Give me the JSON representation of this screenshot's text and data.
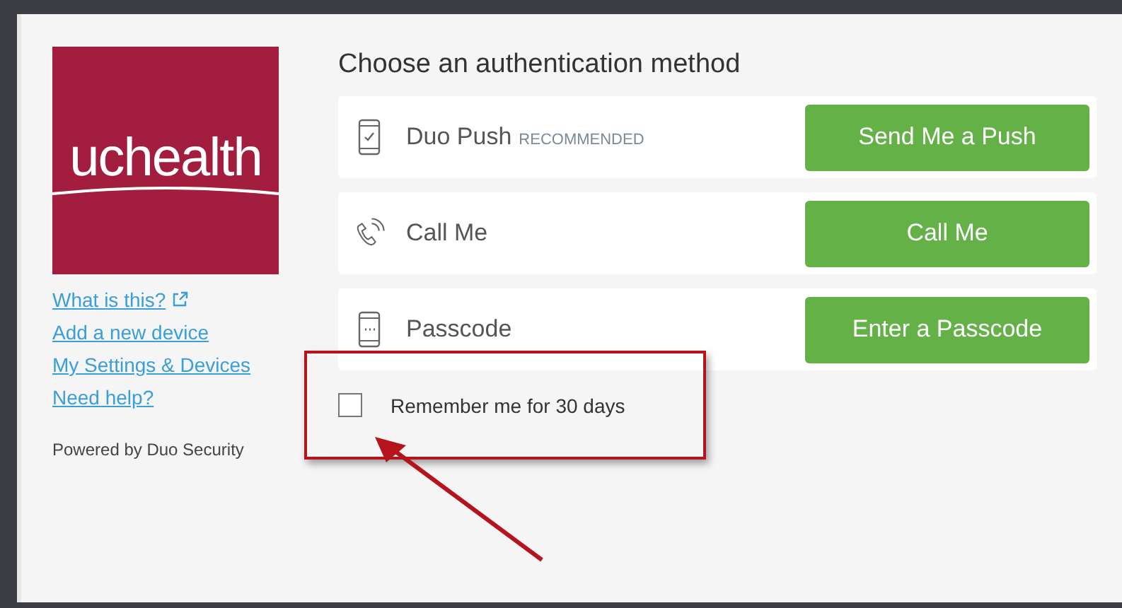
{
  "logo": {
    "text": "uchealth"
  },
  "links": [
    {
      "label": "What is this?",
      "external": true
    },
    {
      "label": "Add a new device",
      "external": false
    },
    {
      "label": "My Settings & Devices",
      "external": false
    },
    {
      "label": "Need help?",
      "external": false
    }
  ],
  "powered_by": "Powered by Duo Security",
  "heading": "Choose an authentication method",
  "methods": [
    {
      "kind": "push",
      "name": "Duo Push",
      "badge": "RECOMMENDED",
      "button": "Send Me a Push"
    },
    {
      "kind": "call",
      "name": "Call Me",
      "button": "Call Me"
    },
    {
      "kind": "passcode",
      "name": "Passcode",
      "button": "Enter a Passcode"
    }
  ],
  "remember": {
    "label": "Remember me for 30 days",
    "checked": false
  }
}
